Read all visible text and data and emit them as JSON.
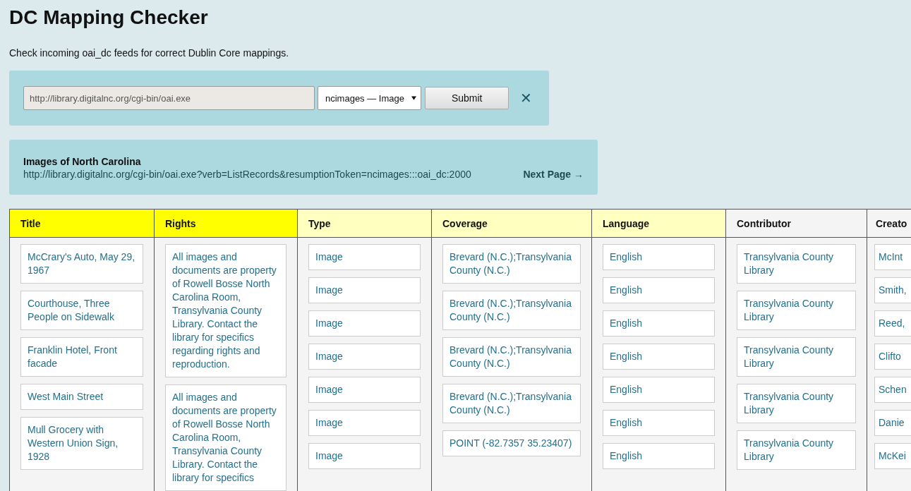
{
  "title": "DC Mapping Checker",
  "intro": "Check incoming oai_dc feeds for correct Dublin Core mappings.",
  "form": {
    "url": "http://library.digitalnc.org/cgi-bin/oai.exe",
    "set": "ncimages — Image",
    "submit": "Submit",
    "clear": "✕"
  },
  "feed": {
    "name": "Images of North Carolina",
    "url": "http://library.digitalnc.org/cgi-bin/oai.exe?verb=ListRecords&resumptionToken=ncimages:::oai_dc:2000",
    "next": "Next Page →"
  },
  "columns": [
    {
      "label": "Title",
      "color": "#ffff00",
      "values": [
        "McCrary's Auto, May 29, 1967",
        "Courthouse, Three People on Sidewalk",
        "Franklin Hotel, Front facade",
        "West Main Street",
        "Mull Grocery with Western Union Sign, 1928"
      ]
    },
    {
      "label": "Rights",
      "color": "#ffff00",
      "values": [
        "All images and documents are property of Rowell Bosse North Carolina Room, Transylvania County Library. Contact the library for specifics regarding rights and reproduction.",
        "All images and documents are property of Rowell Bosse North Carolina Room, Transylvania County Library. Contact the library for specifics"
      ]
    },
    {
      "label": "Type",
      "color": "#ffffc0",
      "values": [
        "Image",
        "Image",
        "Image",
        "Image",
        "Image",
        "Image",
        "Image"
      ]
    },
    {
      "label": "Coverage",
      "color": "#ffffc0",
      "values": [
        "Brevard (N.C.);Transylvania County (N.C.)",
        "Brevard (N.C.);Transylvania County (N.C.)",
        "Brevard (N.C.);Transylvania County (N.C.)",
        "Brevard (N.C.);Transylvania County (N.C.)",
        "POINT (-82.7357 35.23407)"
      ]
    },
    {
      "label": "Language",
      "color": "#ffffc0",
      "values": [
        "English",
        "English",
        "English",
        "English",
        "English",
        "English",
        "English"
      ]
    },
    {
      "label": "Contributor",
      "color": "#f4f4f4",
      "values": [
        "Transylvania County Library",
        "Transylvania County Library",
        "Transylvania County Library",
        "Transylvania County Library",
        "Transylvania County Library"
      ]
    },
    {
      "label": "Creato",
      "color": "#f4f4f4",
      "values": [
        "McInt",
        "Smith,",
        "Reed,",
        "Clifto",
        "Schen",
        "Danie",
        "McKei"
      ]
    }
  ]
}
